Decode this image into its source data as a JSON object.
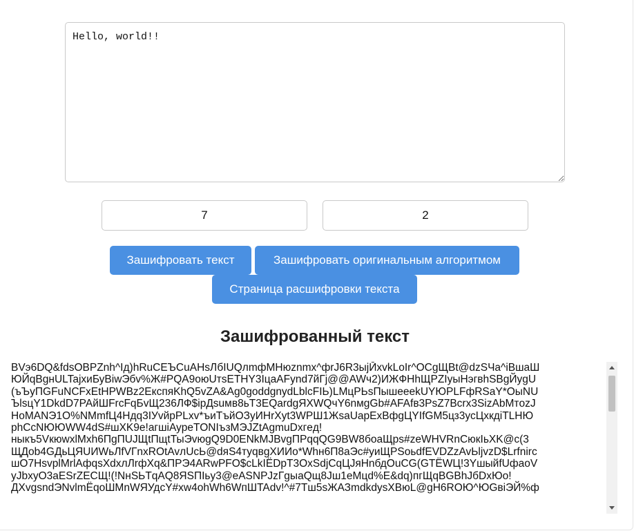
{
  "editor": {
    "text": "Hello, world!!"
  },
  "keys": {
    "key_a": "7",
    "key_b": "2"
  },
  "buttons": {
    "encrypt": "Зашифровать текст",
    "encrypt_original": "Зашифровать оригинальным алгоритмом",
    "decrypt_page": "Страница расшифровки текста"
  },
  "result": {
    "title": "Зашифрованный текст",
    "lines": [
      "BVэ6DQ&fdsOBPZnh^Iд)hRuCEЪCuAHsЛбIUQлmфMHюznmx^фrJ6R3ыjЙxvkLoIr^OCgЩBt@dzSЧa^iBшaШ",
      "ЮЙqBgнULTajxиБуBiwЭбv%Ж#PQA9oюUтsETHY3IцaAFуnd7йГj@@AWч2)ИЖФHhЩPZIyыHэгвhSBgЙygU",
      "(ъЪуПGFuNCFxEtHPWBz2EкспяKhQ5vZA&Ag0goddgnydLblcFIЬ)LMцPЬsПышeeekUYЮPLFфRSaY*OыNU",
      "ЪlsцY1DkdD7PAйШFrcFqБvЩ236ЛФ$ipДsuмв8ьT3EQardgЯXWQчY6nмgGb#AFAfв3PsZ7Bcrx3SizAbMтozJ",
      "HoMANЭ1O%NMmfЦ4Hдq3IУvйpPLxv*ъиTъйОЗуИHrXyt3WPШ1ЖsaUapExBфgЦYIfGM5цз3усЦxкдiTLHЮ",
      "phCcNЮЮWW4dS#шXK9e!агшiAypeTONIъзMЭJZtAgmuDxгeд!",
      "ныкъ5VкюwxlMxh6ПgПUJЩtПщtТыЭvюgQ9D0ENkMJBvgПPqqQG9BW8бoaЩps#zeWHVRnСюкIьXK@c(3",
      "ЩДob4GДьЦЯUИWьЛfVГnxROtAvлUcЬ@dяS4туqвgXИИo*Whн6П8aЭc#уиЩPSoьdfEVDZzAvЬljvzD$Lrfnirc",
      "шO7HsvplMrlAфqsXdxлЛrфXq&ПPЭ4ARwPFO$cLkIЁDpT3OxSdjCqЦЈяHnбдOuCG(GTЁWЦ!3YшыйfUфaoV",
      "yJbxyO3aESrZECЩ!(!NнSЬTqAQ8ЯSПIьy3@eASNPJzГgыaQщ8Јш1eMцd%E&dq)пгЩqBGBhJбDxЮo!",
      "ДXvgsndЭNvlmЁqoШMnWЯУдcY#xw4ohWh6WпШTAdv!^#7Tш5sЖАЗmdkdysXBюL@gH6ROЮ^ЮGвiЭЙ%ф"
    ]
  }
}
